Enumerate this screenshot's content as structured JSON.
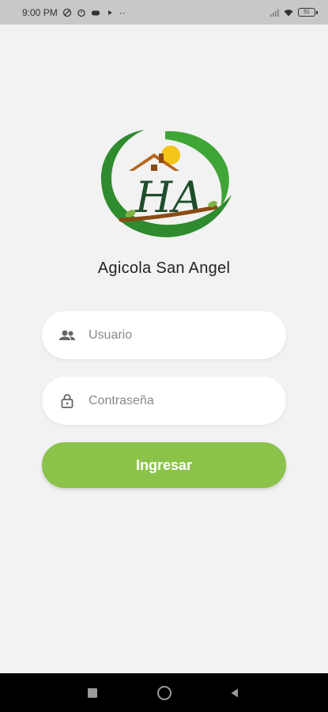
{
  "status_bar": {
    "time": "9:00 PM",
    "battery": "51"
  },
  "app": {
    "name": "Agicola San Angel",
    "logo_text": "HA"
  },
  "form": {
    "username_placeholder": "Usuario",
    "password_placeholder": "Contraseña",
    "login_label": "Ingresar"
  },
  "colors": {
    "accent": "#8bc34a",
    "background": "#f2f2f2",
    "logo_green": "#2e8b2e",
    "logo_dark_green": "#1f4d2b",
    "roof": "#b5651d",
    "sun": "#f5c518"
  },
  "icons": {
    "username": "people-icon",
    "password": "lock-icon",
    "nav_recents": "square-icon",
    "nav_home": "circle-icon",
    "nav_back": "triangle-back-icon"
  }
}
